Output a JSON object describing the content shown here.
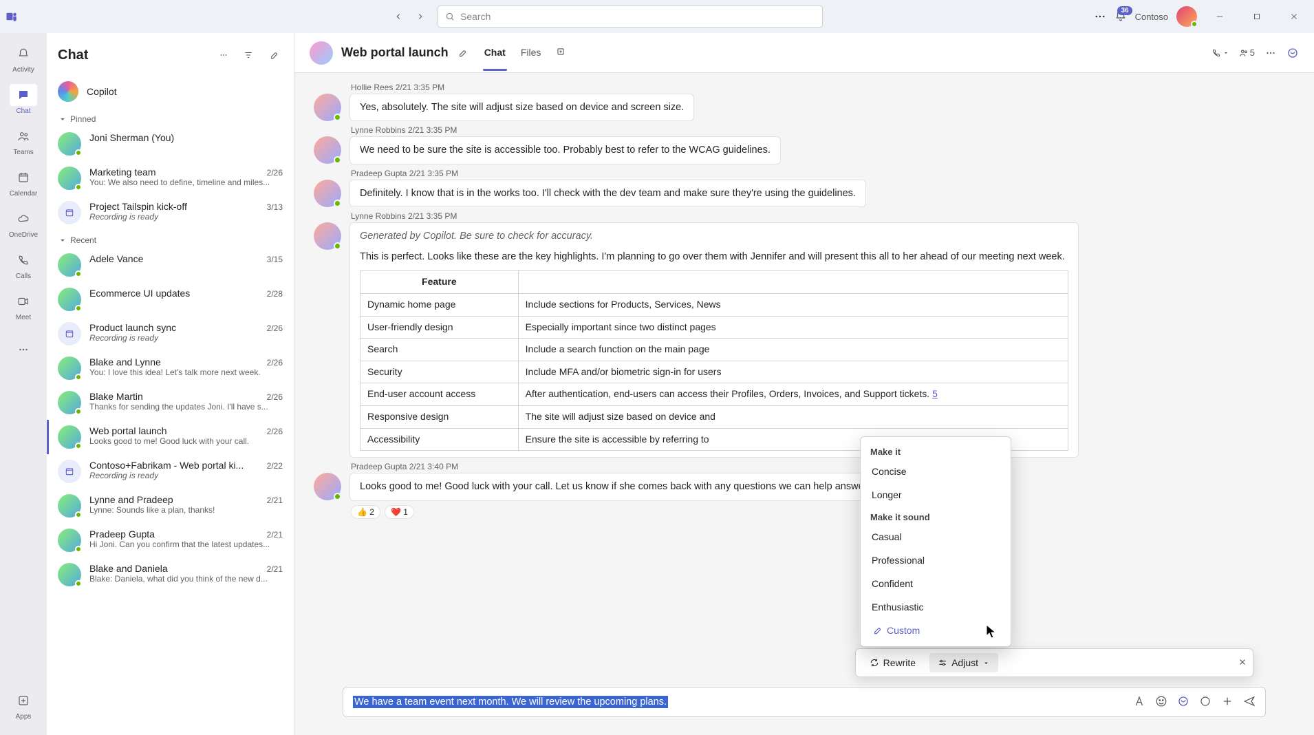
{
  "titlebar": {
    "search_placeholder": "Search",
    "badge_count": "36",
    "org_name": "Contoso"
  },
  "rail": {
    "items": [
      {
        "label": "Activity"
      },
      {
        "label": "Chat"
      },
      {
        "label": "Teams"
      },
      {
        "label": "Calendar"
      },
      {
        "label": "OneDrive"
      },
      {
        "label": "Calls"
      },
      {
        "label": "Meet"
      }
    ],
    "apps_label": "Apps"
  },
  "chatlist": {
    "title": "Chat",
    "copilot_label": "Copilot",
    "section_pinned": "Pinned",
    "section_recent": "Recent",
    "pinned": [
      {
        "title": "Joni Sherman (You)",
        "preview": "",
        "date": ""
      },
      {
        "title": "Marketing team",
        "preview": "You: We also need to define, timeline and miles...",
        "date": "2/26"
      },
      {
        "title": "Project Tailspin kick-off",
        "preview": "Recording is ready",
        "date": "3/13",
        "italic": true,
        "cal": true
      }
    ],
    "recent": [
      {
        "title": "Adele Vance",
        "preview": "",
        "date": "3/15"
      },
      {
        "title": "Ecommerce UI updates",
        "preview": "",
        "date": "2/28"
      },
      {
        "title": "Product launch sync",
        "preview": "Recording is ready",
        "date": "2/26",
        "italic": true,
        "cal": true
      },
      {
        "title": "Blake and Lynne",
        "preview": "You: I love this idea! Let's talk more next week.",
        "date": "2/26"
      },
      {
        "title": "Blake Martin",
        "preview": "Thanks for sending the updates Joni. I'll have s...",
        "date": "2/26"
      },
      {
        "title": "Web portal launch",
        "preview": "Looks good to me! Good luck with your call.",
        "date": "2/26",
        "selected": true
      },
      {
        "title": "Contoso+Fabrikam - Web portal ki...",
        "preview": "Recording is ready",
        "date": "2/22",
        "italic": true,
        "cal": true
      },
      {
        "title": "Lynne and Pradeep",
        "preview": "Lynne: Sounds like a plan, thanks!",
        "date": "2/21"
      },
      {
        "title": "Pradeep Gupta",
        "preview": "Hi Joni. Can you confirm that the latest updates...",
        "date": "2/21"
      },
      {
        "title": "Blake and Daniela",
        "preview": "Blake: Daniela, what did you think of the new d...",
        "date": "2/21"
      }
    ]
  },
  "conversation": {
    "title": "Web portal launch",
    "tabs": {
      "chat": "Chat",
      "files": "Files"
    },
    "people_count": "5",
    "messages": [
      {
        "author": "Hollie Rees",
        "time": "2/21 3:35 PM",
        "text": "Yes, absolutely. The site will adjust size based on device and screen size."
      },
      {
        "author": "Lynne Robbins",
        "time": "2/21 3:35 PM",
        "text": "We need to be sure the site is accessible too. Probably best to refer to the WCAG guidelines."
      },
      {
        "author": "Pradeep Gupta",
        "time": "2/21 3:35 PM",
        "text": "Definitely. I know that is in the works too. I'll check with the dev team and make sure they're using the guidelines."
      }
    ],
    "copilot_msg": {
      "author": "Lynne Robbins",
      "time": "2/21 3:35 PM",
      "note": "Generated by Copilot. Be sure to check for accuracy.",
      "intro": "This is perfect. Looks like these are the key highlights. I'm planning to go over them with Jennifer and will present this all to her ahead of our meeting next week.",
      "table_header_feature": "Feature",
      "rows": [
        {
          "f": "Dynamic home page",
          "d": "Include sections for Products, Services, News"
        },
        {
          "f": "User-friendly design",
          "d": "Especially important since two distinct pages"
        },
        {
          "f": "Search",
          "d": "Include a search function on the main page"
        },
        {
          "f": "Security",
          "d": "Include MFA and/or biometric sign-in for users"
        },
        {
          "f": "End-user account access",
          "d": "After authentication, end-users can access their Profiles, Orders, Invoices, and Support tickets.",
          "link": "5"
        },
        {
          "f": "Responsive design",
          "d": "The site will adjust size based on device and"
        },
        {
          "f": "Accessibility",
          "d": "Ensure the site is accessible by referring to"
        }
      ]
    },
    "final_msg": {
      "author": "Pradeep Gupta",
      "time": "2/21 3:40 PM",
      "text": "Looks good to me! Good luck with your call. Let us know if she comes back with any questions we can help answer before the on-site meeting.",
      "reactions": [
        {
          "emoji": "👍",
          "count": "2"
        },
        {
          "emoji": "❤️",
          "count": "1"
        }
      ]
    }
  },
  "compose": {
    "draft": "We have a team event next month. We will review the upcoming plans."
  },
  "ai": {
    "rewrite": "Rewrite",
    "adjust": "Adjust",
    "menu": {
      "hdr1": "Make it",
      "concise": "Concise",
      "longer": "Longer",
      "hdr2": "Make it sound",
      "casual": "Casual",
      "professional": "Professional",
      "confident": "Confident",
      "enthusiastic": "Enthusiastic",
      "custom": "Custom"
    }
  }
}
